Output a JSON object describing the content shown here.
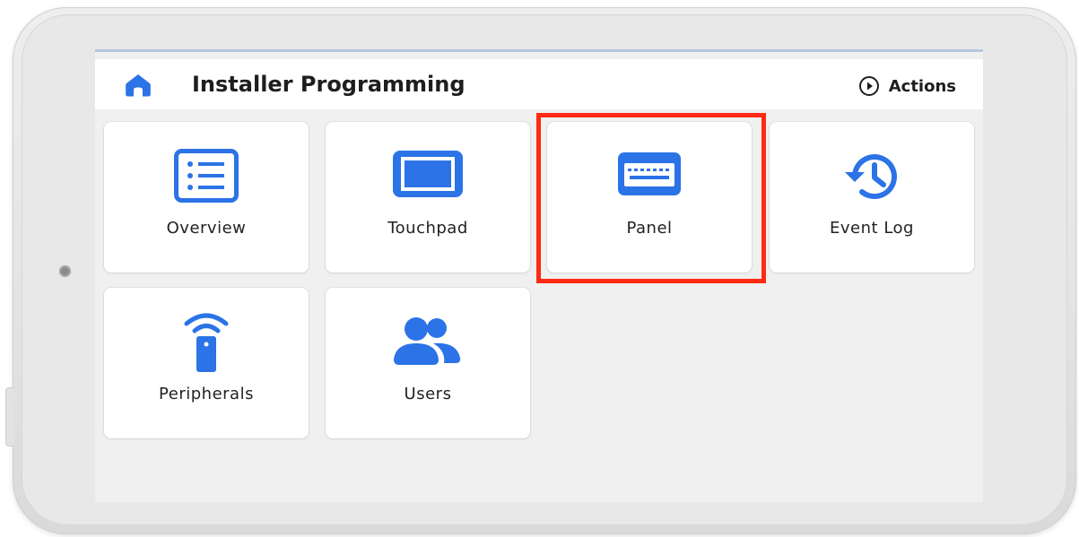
{
  "header": {
    "title": "Installer Programming",
    "home_icon": "home-icon",
    "actions_label": "Actions",
    "actions_icon": "play-circle-icon"
  },
  "tiles": [
    {
      "label": "Overview",
      "icon": "list-icon"
    },
    {
      "label": "Touchpad",
      "icon": "tablet-icon"
    },
    {
      "label": "Panel",
      "icon": "keyboard-icon"
    },
    {
      "label": "Event Log",
      "icon": "history-icon"
    },
    {
      "label": "Peripherals",
      "icon": "remote-wireless-icon"
    },
    {
      "label": "Users",
      "icon": "users-icon"
    }
  ],
  "highlight": {
    "target": "Panel",
    "color": "#ff2a14"
  },
  "colors": {
    "accent": "#2b73e6",
    "screen_bg": "#f0f0f0",
    "tile_bg": "#ffffff"
  }
}
